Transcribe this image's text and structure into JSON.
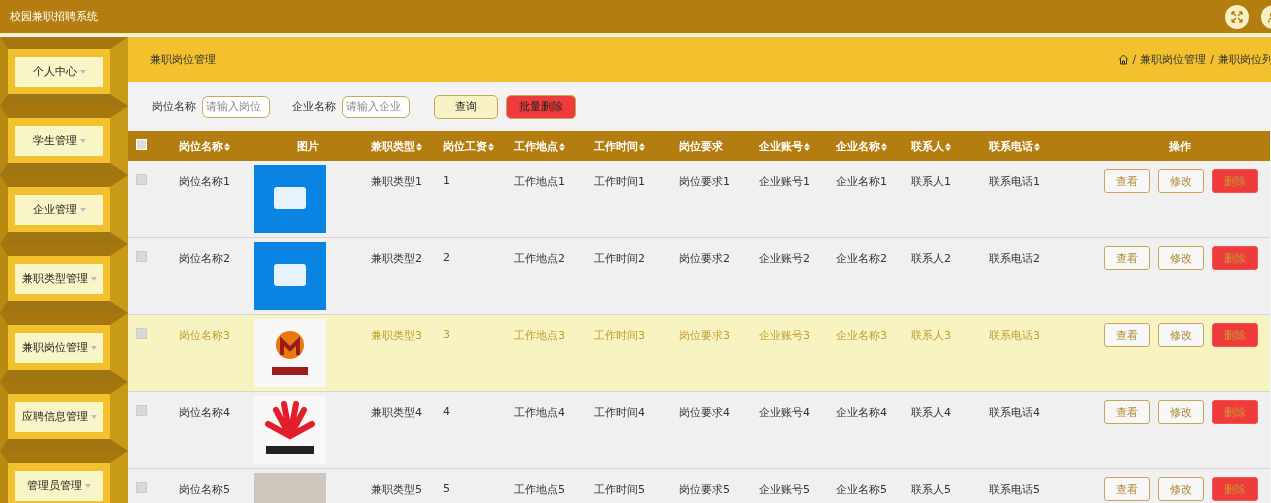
{
  "app": {
    "title": "校园兼职招聘系统"
  },
  "sidebar": {
    "items": [
      {
        "label": "个人中心"
      },
      {
        "label": "学生管理"
      },
      {
        "label": "企业管理"
      },
      {
        "label": "兼职类型管理"
      },
      {
        "label": "兼职岗位管理"
      },
      {
        "label": "应聘信息管理"
      },
      {
        "label": "管理员管理"
      }
    ]
  },
  "page_header": {
    "title": "兼职岗位管理",
    "breadcrumb": [
      {
        "separator": "/",
        "label": "兼职岗位管理"
      },
      {
        "separator": "/",
        "label": "兼职岗位列"
      }
    ]
  },
  "search": {
    "fields": [
      {
        "label": "岗位名称",
        "placeholder": "请输入岗位"
      },
      {
        "label": "企业名称",
        "placeholder": "请输入企业"
      }
    ],
    "buttons": [
      {
        "label": "查询",
        "kind": "query"
      },
      {
        "label": "批量删除",
        "kind": "danger"
      }
    ]
  },
  "table": {
    "select_all": {
      "checked": false
    },
    "columns": [
      {
        "label": "岗位名称",
        "sortable": true
      },
      {
        "label": "图片",
        "sortable": false
      },
      {
        "label": "兼职类型",
        "sortable": true
      },
      {
        "label": "岗位工资",
        "sortable": true
      },
      {
        "label": "工作地点",
        "sortable": true
      },
      {
        "label": "工作时间",
        "sortable": true
      },
      {
        "label": "岗位要求",
        "sortable": false
      },
      {
        "label": "企业账号",
        "sortable": true
      },
      {
        "label": "企业名称",
        "sortable": true
      },
      {
        "label": "联系人",
        "sortable": true
      },
      {
        "label": "联系电话",
        "sortable": true
      },
      {
        "label": "操作",
        "sortable": false
      }
    ],
    "rows": [
      {
        "checked": false,
        "hovered": false,
        "cells": [
          "岗位名称1",
          {
            "kind": "blue-logo"
          },
          "兼职类型1",
          "1",
          "工作地点1",
          "工作时间1",
          "岗位要求1",
          "企业账号1",
          "企业名称1",
          "联系人1",
          "联系电话1"
        ],
        "actions": [
          {
            "label": "查看",
            "kind": "view"
          },
          {
            "label": "修改",
            "kind": "edit"
          },
          {
            "label": "删除",
            "kind": "delete"
          }
        ]
      },
      {
        "checked": false,
        "hovered": false,
        "cells": [
          "岗位名称2",
          {
            "kind": "blue-logo"
          },
          "兼职类型2",
          "2",
          "工作地点2",
          "工作时间2",
          "岗位要求2",
          "企业账号2",
          "企业名称2",
          "联系人2",
          "联系电话2"
        ],
        "actions": [
          {
            "label": "查看",
            "kind": "view"
          },
          {
            "label": "修改",
            "kind": "edit"
          },
          {
            "label": "删除",
            "kind": "delete"
          }
        ]
      },
      {
        "checked": false,
        "hovered": true,
        "cells": [
          "岗位名称3",
          {
            "kind": "emblem-logo"
          },
          "兼职类型3",
          "3",
          "工作地点3",
          "工作时间3",
          "岗位要求3",
          "企业账号3",
          "企业名称3",
          "联系人3",
          "联系电话3"
        ],
        "actions": [
          {
            "label": "查看",
            "kind": "view"
          },
          {
            "label": "修改",
            "kind": "edit"
          },
          {
            "label": "删除",
            "kind": "delete"
          }
        ]
      },
      {
        "checked": false,
        "hovered": false,
        "cells": [
          "岗位名称4",
          {
            "kind": "fan-logo"
          },
          "兼职类型4",
          "4",
          "工作地点4",
          "工作时间4",
          "岗位要求4",
          "企业账号4",
          "企业名称4",
          "联系人4",
          "联系电话4"
        ],
        "actions": [
          {
            "label": "查看",
            "kind": "view"
          },
          {
            "label": "修改",
            "kind": "edit"
          },
          {
            "label": "删除",
            "kind": "delete"
          }
        ]
      },
      {
        "checked": false,
        "hovered": false,
        "cells": [
          "岗位名称5",
          {
            "kind": "photo"
          },
          "兼职类型5",
          "5",
          "工作地点5",
          "工作时间5",
          "岗位要求5",
          "企业账号5",
          "企业名称5",
          "联系人5",
          "联系电话5"
        ],
        "actions": [
          {
            "label": "查看",
            "kind": "view"
          },
          {
            "label": "修改",
            "kind": "edit"
          },
          {
            "label": "删除",
            "kind": "delete"
          }
        ]
      }
    ]
  }
}
